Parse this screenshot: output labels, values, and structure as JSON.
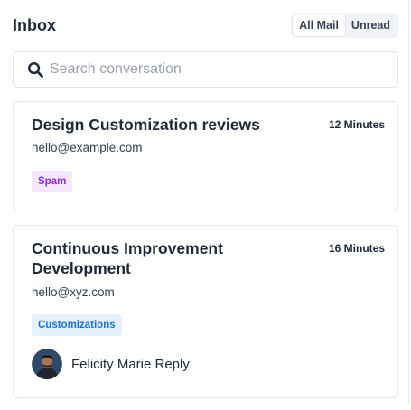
{
  "header": {
    "title": "Inbox",
    "filters": [
      {
        "label": "All Mail",
        "active": true
      },
      {
        "label": "Unread",
        "active": false
      }
    ]
  },
  "search": {
    "placeholder": "Search conversation",
    "value": "",
    "icon": "search-icon"
  },
  "conversations": [
    {
      "subject": "Design Customization reviews",
      "time": "12 Minutes",
      "email": "hello@example.com",
      "tag": "Spam",
      "tag_color": "#8b2fd6",
      "tag_bg": "#f3e8ff"
    },
    {
      "subject": "Continuous Improvement Development",
      "time": "16 Minutes",
      "email": "hello@xyz.com",
      "tag": "Customizations",
      "tag_color": "#1f6fd1",
      "tag_bg": "#e6f1fe",
      "reply": {
        "name": "Felicity Marie Reply",
        "avatar": "avatar-icon"
      }
    }
  ]
}
